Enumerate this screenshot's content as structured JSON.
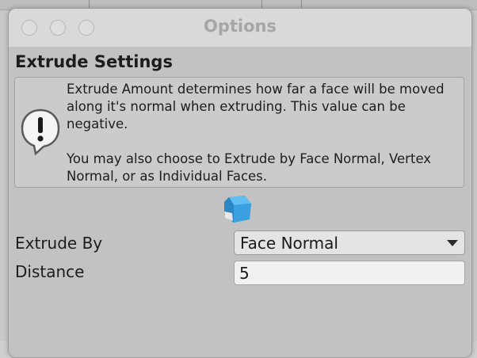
{
  "window": {
    "title": "Options"
  },
  "section": {
    "title": "Extrude Settings"
  },
  "help": {
    "icon": "warning-icon",
    "text": "Extrude Amount determines how far a face will be moved\nalong it's normal when extruding.  This value can be\nnegative.\n\nYou may also choose to Extrude by Face Normal, Vertex\nNormal, or as Individual Faces."
  },
  "preview": {
    "icon": "extrude-cube-icon"
  },
  "extrude_by": {
    "label": "Extrude By",
    "value": "Face Normal"
  },
  "distance": {
    "label": "Distance",
    "value": "5"
  },
  "colors": {
    "window_bg": "#c2c2c2",
    "titlebar_bg": "#d9d9d9",
    "cube_blue": "#3aa0df"
  }
}
